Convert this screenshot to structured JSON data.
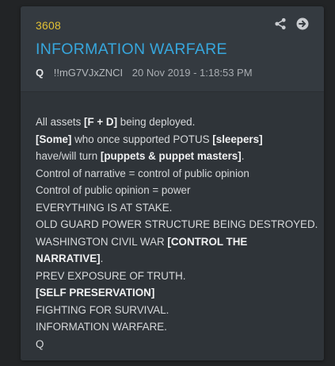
{
  "post": {
    "number": "3608",
    "title": "INFORMATION WARFARE",
    "author": "Q",
    "tripcode": "!!mG7VJxZNCI",
    "timestamp": "20 Nov 2019 - 1:18:53 PM"
  },
  "actions": {
    "share_icon": "share-icon",
    "go_icon": "arrow-right-circle-icon"
  },
  "body_lines": {
    "l1a": "All assets ",
    "l1b": "[F + D]",
    "l1c": " being deployed.",
    "l2a": "[Some]",
    "l2b": " who once supported POTUS ",
    "l2c": "[sleepers]",
    "l3a": "have/will turn ",
    "l3b": "[puppets & puppet masters]",
    "l3c": ".",
    "l4": "Control of narrative = control of public opinion",
    "l5": "Control of public opinion = power",
    "l6": "EVERYTHING IS AT STAKE.",
    "l7": "OLD GUARD POWER STRUCTURE BEING DESTROYED.",
    "l8a": "WASHINGTON CIVIL WAR ",
    "l8b": "[CONTROL THE",
    "l9a": "NARRATIVE]",
    "l9b": ".",
    "l10": "PREV EXPOSURE OF TRUTH.",
    "l11": "[SELF PRESERVATION]",
    "l12": "FIGHTING FOR SURVIVAL.",
    "l13": "INFORMATION WARFARE.",
    "l14": "Q"
  },
  "colors": {
    "page_background": "#222426",
    "card_background": "#343a40",
    "post_number": "#e0c035",
    "title": "#37a7dd",
    "body_text": "#d7d9db"
  }
}
